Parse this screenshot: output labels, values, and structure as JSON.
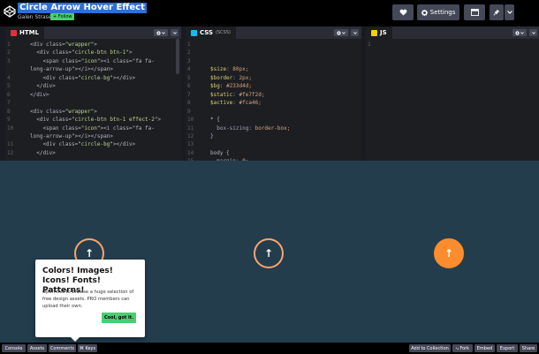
{
  "header": {
    "title": "Circle Arrow Hover Effect",
    "author": "Galen Strasen",
    "follow_label": "+ Follow",
    "settings_label": "Settings"
  },
  "panes": {
    "html": {
      "label": "HTML",
      "color": "#e2303a",
      "line_numbers": [
        "1",
        "2",
        "3",
        "4",
        "5",
        "6",
        "7",
        "8",
        "9",
        "10",
        "11",
        "12"
      ],
      "lines": [
        {
          "pre": "<div class=",
          "str": "\"wrapper\"",
          "post": ">"
        },
        {
          "pre": "  <div class=",
          "str": "\"circle-btn btn-1\"",
          "post": ">"
        },
        {
          "pre": "    <span class=",
          "str": "\"icon\"",
          "post": "><i class=\"fa fa-"
        },
        {
          "pre": "long-arrow-up\"",
          "str": "",
          "post": "></i></span>"
        },
        {
          "pre": "    <div class=",
          "str": "\"circle-bg\"",
          "post": "></div>"
        },
        {
          "pre": "  </div>",
          "str": "",
          "post": ""
        },
        {
          "pre": "</div>",
          "str": "",
          "post": ""
        },
        {
          "pre": "",
          "str": "",
          "post": ""
        },
        {
          "pre": "<div class=",
          "str": "\"wrapper\"",
          "post": ">"
        },
        {
          "pre": "  <div class=",
          "str": "\"circle-btn btn-1 effect-2\"",
          "post": ">"
        },
        {
          "pre": "    <span class=",
          "str": "\"icon\"",
          "post": "><i class=\"fa fa-"
        },
        {
          "pre": "long-arrow-up\"",
          "str": "",
          "post": "></i></span>"
        },
        {
          "pre": "    <div class=",
          "str": "\"circle-bg\"",
          "post": "></div>"
        },
        {
          "pre": "  </div>",
          "str": "",
          "post": ""
        }
      ]
    },
    "css": {
      "label": "CSS",
      "sublabel": "(SCSS)",
      "color": "#0ebeff",
      "line_numbers": [
        "1",
        "2",
        "3",
        "4",
        "5",
        "6",
        "7",
        "8",
        "9",
        "10",
        "11",
        "12",
        "13",
        "14",
        "15"
      ],
      "lines": [
        "",
        "",
        "",
        "$size: 80px;",
        "$border: 2px;",
        "$bg: #233d4d;",
        "$static: #fe7f2d;",
        "$active: #fca46;",
        "",
        "* {",
        "  box-sizing: border-box;",
        "}",
        "",
        "body {",
        "  margin: 0;"
      ]
    },
    "js": {
      "label": "JS",
      "color": "#fcd000",
      "line_numbers": [
        "1"
      ]
    }
  },
  "preview": {
    "bg_color": "#233d4d",
    "accent_color": "#fc8c2e",
    "arrow_glyph": "↑"
  },
  "popup": {
    "title": "Colors! Images! Icons! Fonts! Patterns!",
    "body": "Open this to browse a huge selection of free design assets. PRO members can upload their own.",
    "button": "Cool, got it."
  },
  "footer": {
    "left": [
      "Console",
      "Assets",
      "Comments",
      "⌘ Keys"
    ],
    "right": [
      "Add to Collection",
      "⤷ Fork",
      "Embed",
      "Export",
      "Share"
    ]
  }
}
